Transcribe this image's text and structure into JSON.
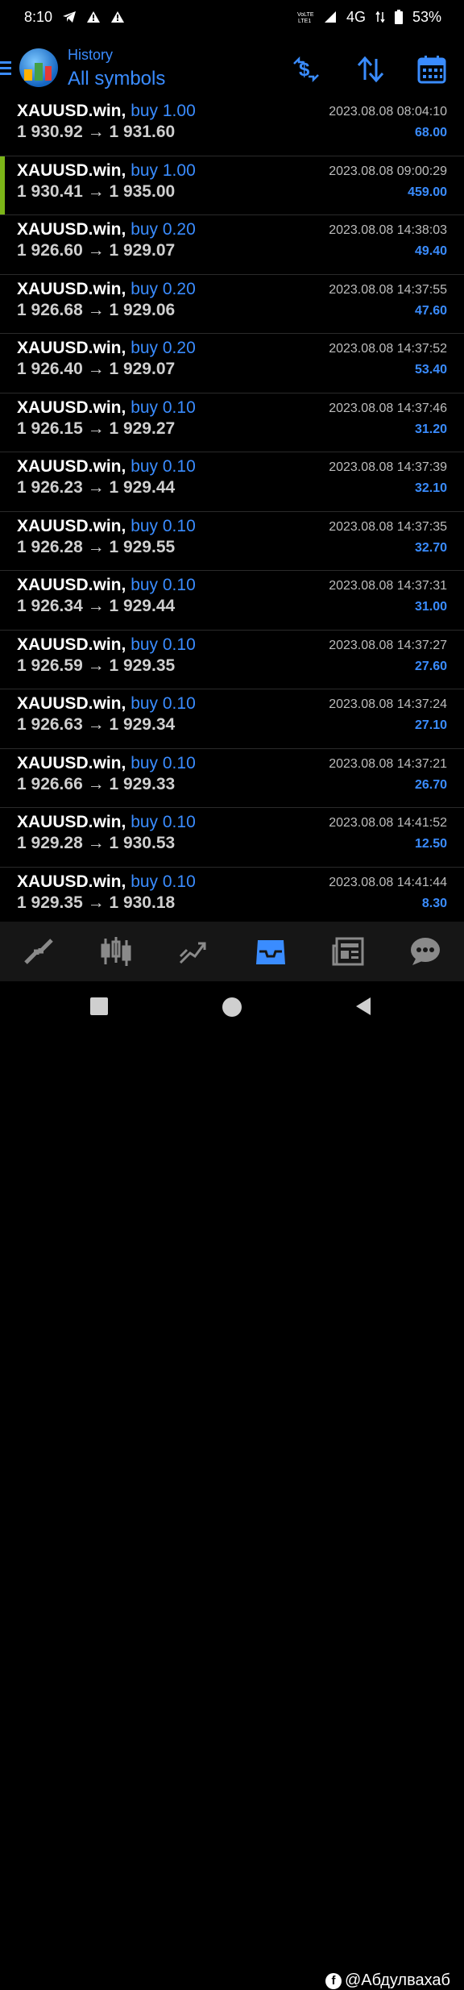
{
  "status": {
    "time": "8:10",
    "network": "4G",
    "battery": "53%"
  },
  "header": {
    "subtitle": "History",
    "title": "All symbols"
  },
  "trades": [
    {
      "symbol": "XAUUSD.win,",
      "side": "buy 1.00",
      "open": "1 930.92",
      "close": "1 931.60",
      "time": "2023.08.08 08:04:10",
      "profit": "68.00"
    },
    {
      "symbol": "XAUUSD.win,",
      "side": "buy 1.00",
      "open": "1 930.41",
      "close": "1 935.00",
      "time": "2023.08.08 09:00:29",
      "profit": "459.00"
    },
    {
      "symbol": "XAUUSD.win,",
      "side": "buy 0.20",
      "open": "1 926.60",
      "close": "1 929.07",
      "time": "2023.08.08 14:38:03",
      "profit": "49.40"
    },
    {
      "symbol": "XAUUSD.win,",
      "side": "buy 0.20",
      "open": "1 926.68",
      "close": "1 929.06",
      "time": "2023.08.08 14:37:55",
      "profit": "47.60"
    },
    {
      "symbol": "XAUUSD.win,",
      "side": "buy 0.20",
      "open": "1 926.40",
      "close": "1 929.07",
      "time": "2023.08.08 14:37:52",
      "profit": "53.40"
    },
    {
      "symbol": "XAUUSD.win,",
      "side": "buy 0.10",
      "open": "1 926.15",
      "close": "1 929.27",
      "time": "2023.08.08 14:37:46",
      "profit": "31.20"
    },
    {
      "symbol": "XAUUSD.win,",
      "side": "buy 0.10",
      "open": "1 926.23",
      "close": "1 929.44",
      "time": "2023.08.08 14:37:39",
      "profit": "32.10"
    },
    {
      "symbol": "XAUUSD.win,",
      "side": "buy 0.10",
      "open": "1 926.28",
      "close": "1 929.55",
      "time": "2023.08.08 14:37:35",
      "profit": "32.70"
    },
    {
      "symbol": "XAUUSD.win,",
      "side": "buy 0.10",
      "open": "1 926.34",
      "close": "1 929.44",
      "time": "2023.08.08 14:37:31",
      "profit": "31.00"
    },
    {
      "symbol": "XAUUSD.win,",
      "side": "buy 0.10",
      "open": "1 926.59",
      "close": "1 929.35",
      "time": "2023.08.08 14:37:27",
      "profit": "27.60"
    },
    {
      "symbol": "XAUUSD.win,",
      "side": "buy 0.10",
      "open": "1 926.63",
      "close": "1 929.34",
      "time": "2023.08.08 14:37:24",
      "profit": "27.10"
    },
    {
      "symbol": "XAUUSD.win,",
      "side": "buy 0.10",
      "open": "1 926.66",
      "close": "1 929.33",
      "time": "2023.08.08 14:37:21",
      "profit": "26.70"
    },
    {
      "symbol": "XAUUSD.win,",
      "side": "buy 0.10",
      "open": "1 929.28",
      "close": "1 930.53",
      "time": "2023.08.08 14:41:52",
      "profit": "12.50"
    },
    {
      "symbol": "XAUUSD.win,",
      "side": "buy 0.10",
      "open": "1 929.35",
      "close": "1 930.18",
      "time": "2023.08.08 14:41:44",
      "profit": "8.30"
    }
  ],
  "price_arrow": "→",
  "watermark": "@Абдулвахаб",
  "colors": {
    "accent": "#3a8cff",
    "selected_marker": "#7cb518",
    "background": "#000000"
  }
}
